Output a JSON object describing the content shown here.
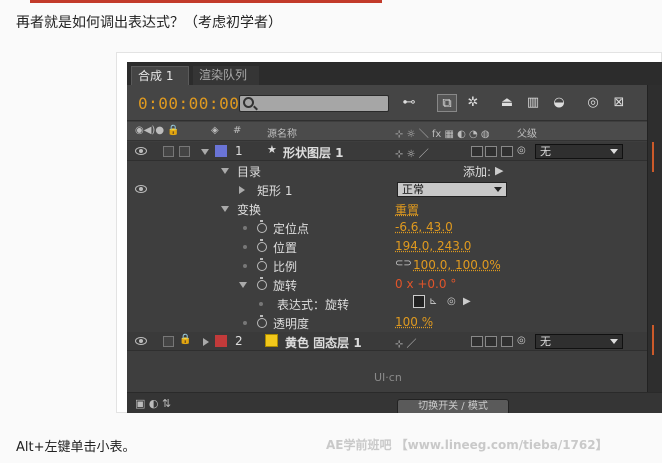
{
  "article": {
    "intro": "再者就是如何调出表达式？（考虑初学者）",
    "outro": "Alt+左键单击小表。",
    "credit": "AE学前班吧 【www.lineeg.com/tieba/1762】"
  },
  "tabs": [
    {
      "label": "合成 1",
      "close": "×"
    },
    {
      "label": "渲染队列"
    }
  ],
  "toolbar": {
    "timecode": "0:00:00:00",
    "search_placeholder": ""
  },
  "columns": {
    "hash": "#",
    "source_name": "源名称",
    "parent": "父级"
  },
  "rows": [
    {
      "kind": "layer",
      "index": "1",
      "name": "形状图层 1",
      "color": "#6a74d6",
      "parent": "无"
    },
    {
      "kind": "group",
      "name": "目录",
      "extra": "添加:"
    },
    {
      "kind": "item",
      "name": "矩形 1",
      "mode": "正常"
    },
    {
      "kind": "group",
      "name": "变换",
      "value": "重置"
    },
    {
      "kind": "prop",
      "name": "定位点",
      "value": "-6.6, 43.0"
    },
    {
      "kind": "prop",
      "name": "位置",
      "value": "194.0, 243.0"
    },
    {
      "kind": "prop",
      "name": "比例",
      "value": "100.0, 100.0%"
    },
    {
      "kind": "prop",
      "name": "旋转",
      "value": "0 x +0.0 °"
    },
    {
      "kind": "expr",
      "name": "表达式：旋转"
    },
    {
      "kind": "prop",
      "name": "透明度",
      "value": "100 %"
    },
    {
      "kind": "layer",
      "index": "2",
      "name": "黄色 固态层 1",
      "color": "#f2c81b",
      "parent": "无"
    }
  ],
  "footer": {
    "toggle_label": "切换开关 / 模式",
    "watermark": "UI·cn"
  },
  "colors": {
    "accent": "#e09a1f",
    "panel": "#3e3e3e"
  }
}
